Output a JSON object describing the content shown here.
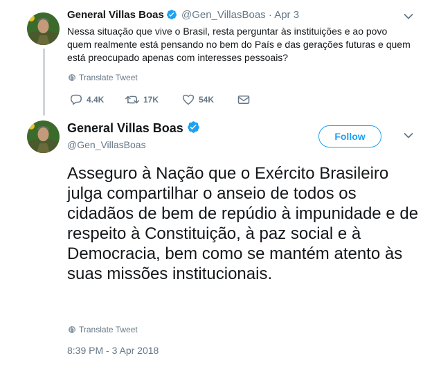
{
  "tweet1": {
    "display_name": "General Villas Boas",
    "handle": "@Gen_VillasBoas",
    "separator": "·",
    "date": "Apr 3",
    "text": "Nessa situação que vive o Brasil, resta perguntar às instituições e ao povo quem realmente está pensando no bem do País e das gerações futuras e quem está preocupado apenas com interesses pessoais?",
    "translate_label": "Translate Tweet",
    "actions": {
      "replies": "4.4K",
      "retweets": "17K",
      "likes": "54K"
    }
  },
  "tweet2": {
    "display_name": "General Villas Boas",
    "handle": "@Gen_VillasBoas",
    "follow_label": "Follow",
    "text": "Asseguro à Nação que o Exército Brasileiro julga compartilhar o anseio de todos os cidadãos de bem de repúdio à impunidade e de respeito à Constituição, à paz social e à Democracia, bem como se mantém atento às suas missões institucionais.",
    "translate_label": "Translate Tweet",
    "timestamp": "8:39 PM - 3 Apr 2018"
  },
  "colors": {
    "accent": "#1da1f2",
    "muted": "#657786",
    "text": "#14171a",
    "thread_line": "#ccd6dd"
  },
  "icons": [
    "verified-badge-icon",
    "chevron-down-icon",
    "globe-icon",
    "reply-icon",
    "retweet-icon",
    "heart-icon",
    "envelope-icon"
  ]
}
